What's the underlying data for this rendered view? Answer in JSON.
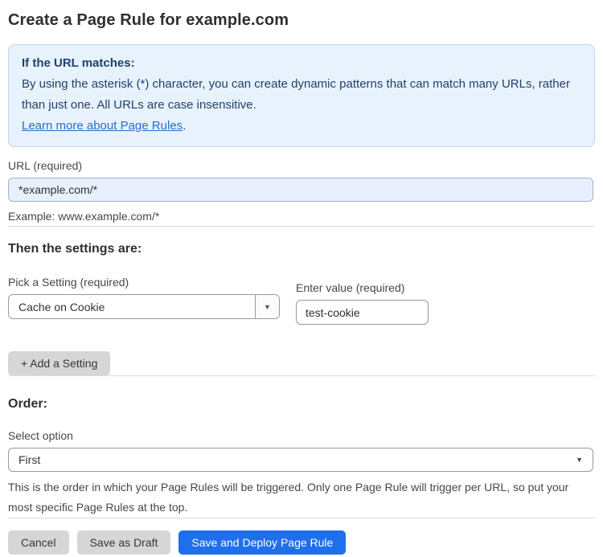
{
  "page": {
    "title": "Create a Page Rule for example.com"
  },
  "info_box": {
    "heading": "If the URL matches:",
    "body": "By using the asterisk (*) character, you can create dynamic patterns that can match many URLs, rather than just one. All URLs are case insensitive.",
    "link_label": "Learn more about Page Rules",
    "link_suffix": "."
  },
  "url_field": {
    "label": "URL (required)",
    "value": "*example.com/*",
    "helper": "Example: www.example.com/*"
  },
  "settings_section": {
    "heading": "Then the settings are:",
    "setting_select": {
      "label": "Pick a Setting (required)",
      "value": "Cache on Cookie"
    },
    "value_field": {
      "label": "Enter value (required)",
      "value": "test-cookie"
    },
    "add_setting_label": "+ Add a Setting"
  },
  "order_section": {
    "heading": "Order:",
    "select_label": "Select option",
    "select_value": "First",
    "helper": "This is the order in which your Page Rules will be triggered. Only one Page Rule will trigger per URL, so put your most specific Page Rules at the top."
  },
  "footer": {
    "cancel_label": "Cancel",
    "save_draft_label": "Save as Draft",
    "save_deploy_label": "Save and Deploy Page Rule"
  },
  "icons": {
    "dropdown_arrow": "▼"
  },
  "colors": {
    "accent_blue": "#1f6fed",
    "info_bg": "#e8f2fc",
    "info_border": "#bcd7f1",
    "info_text": "#223f6f",
    "link_blue": "#2e6bc4",
    "url_input_bg": "#e8f0fe",
    "gray_button": "#d6d6d6"
  }
}
